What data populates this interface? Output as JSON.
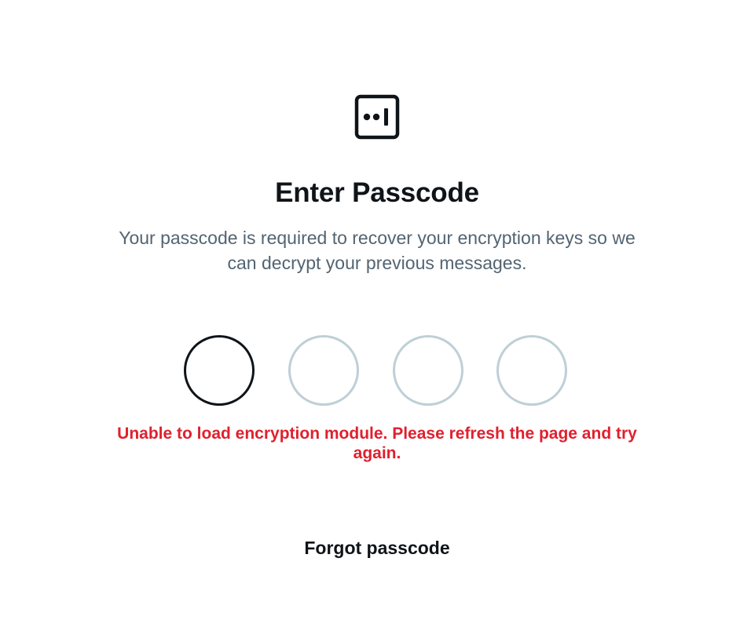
{
  "header": {
    "logo_icon": "passcode-lock-icon",
    "title": "Enter Passcode",
    "subtitle": "Your passcode is required to recover your encryption keys so we can decrypt your previous messages."
  },
  "passcode": {
    "digit_count": 4,
    "active_index": 0,
    "colors": {
      "active_border": "#0f1419",
      "inactive_border": "#bfcfd6"
    }
  },
  "error": {
    "message": "Unable to load encryption module. Please refresh the page and try again.",
    "color": "#e0202e"
  },
  "actions": {
    "forgot_label": "Forgot passcode"
  }
}
